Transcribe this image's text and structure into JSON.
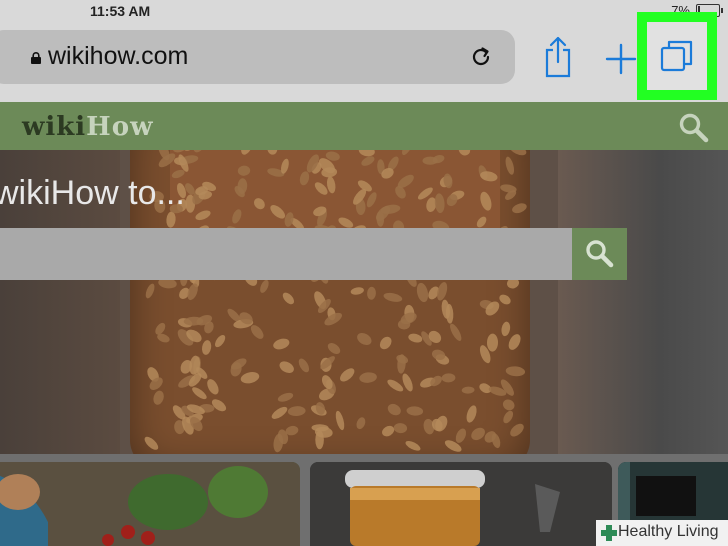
{
  "status_bar": {
    "time": "11:53 AM",
    "battery_percent": "7%"
  },
  "browser": {
    "url": "wikihow.com",
    "icons": {
      "lock": "lock-icon",
      "reload": "reload-icon",
      "share": "share-icon",
      "new_tab": "plus-icon",
      "tabs": "tabs-icon"
    },
    "accent_color": "#1b7bd9",
    "highlight_color": "#22ff22"
  },
  "site": {
    "logo_wiki": "wiki",
    "logo_how": "How",
    "brand_color": "#6c8a58",
    "hero_title": "wikiHow to...",
    "search_placeholder": ""
  },
  "watermark": {
    "label": "Healthy Living"
  }
}
